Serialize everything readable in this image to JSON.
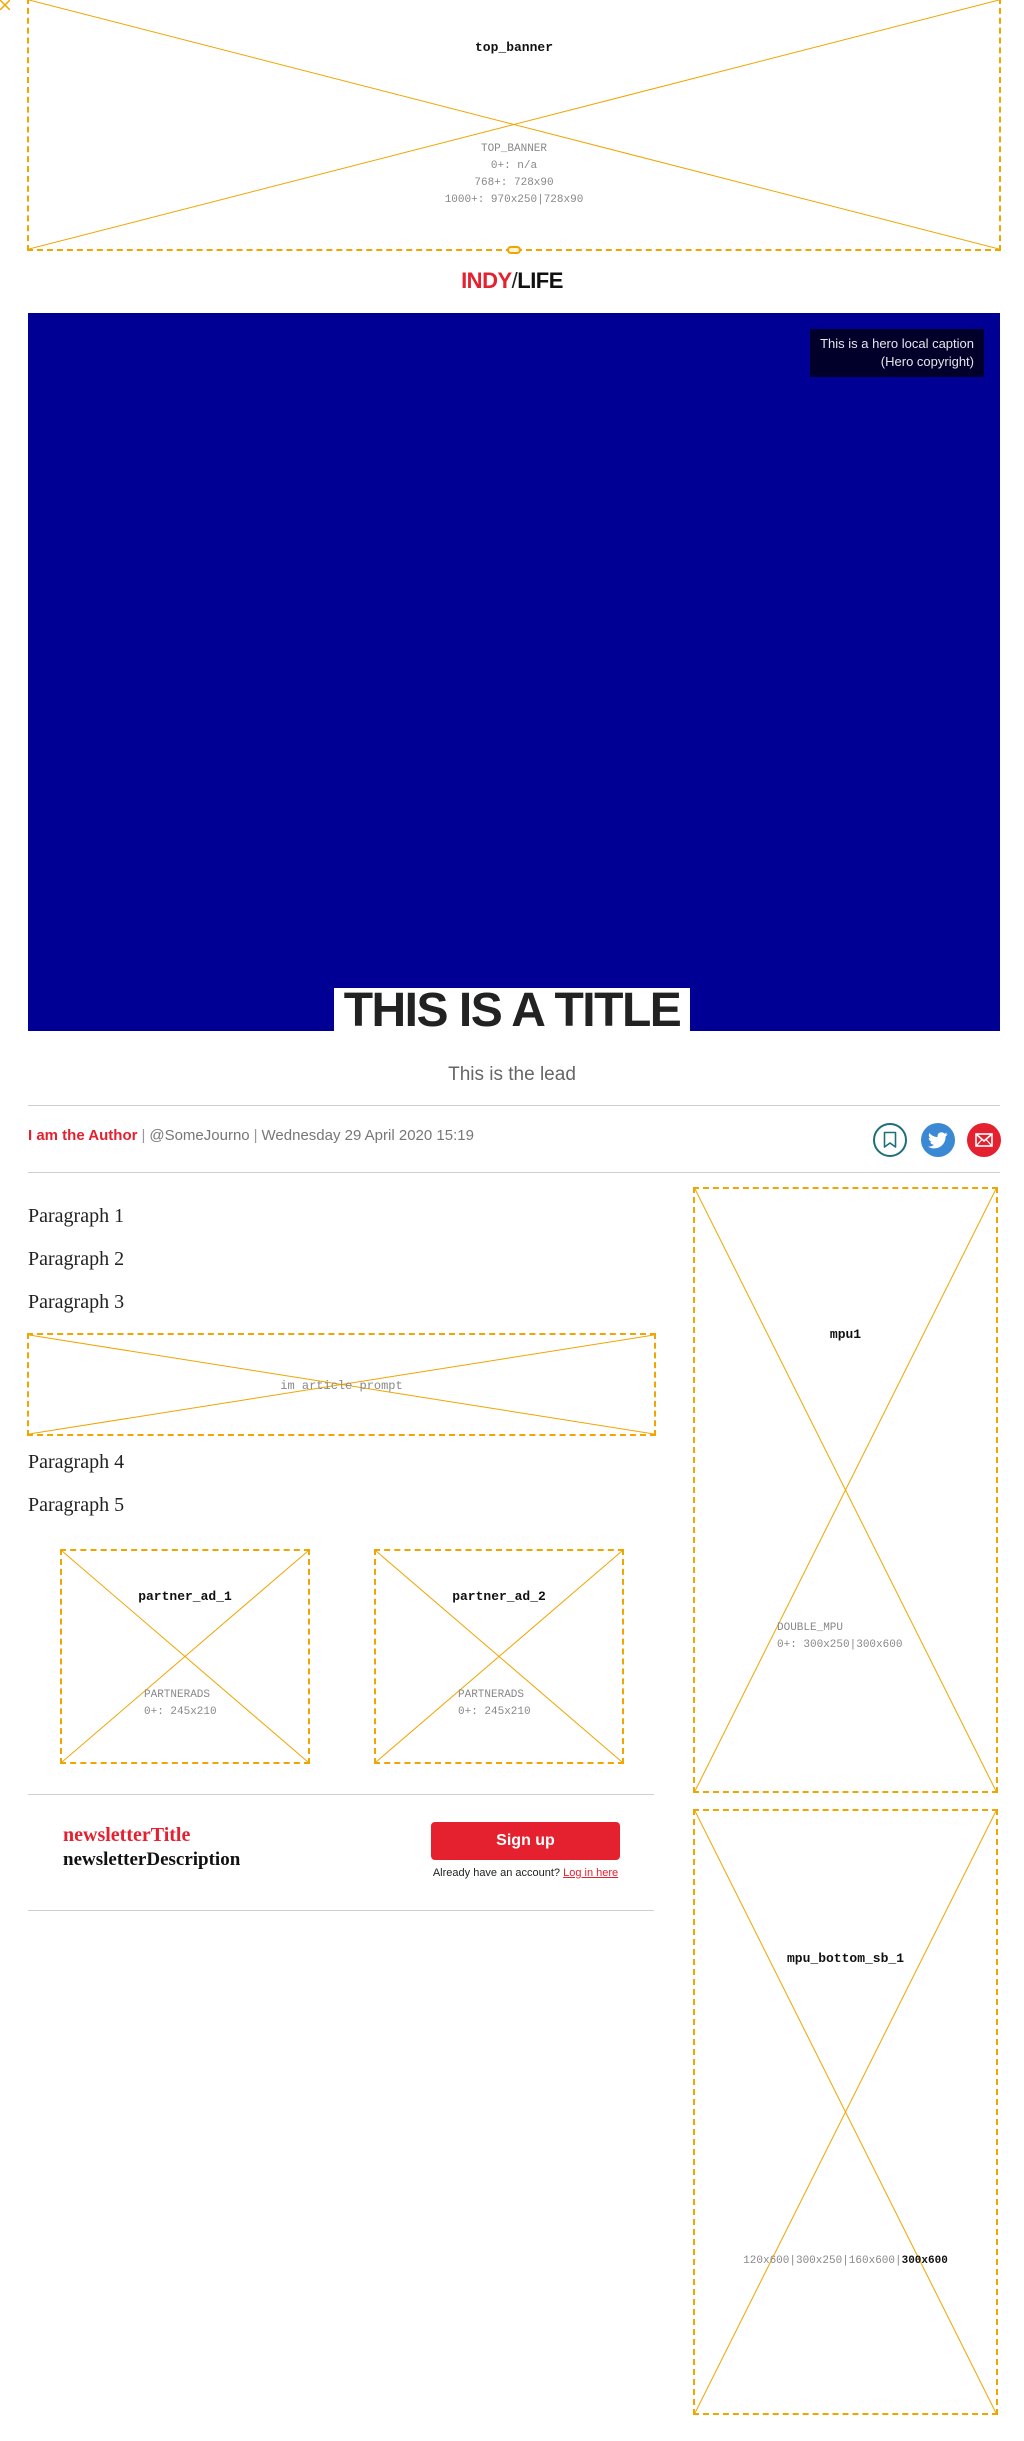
{
  "ads": {
    "top_banner": {
      "name": "top_banner",
      "info": [
        "TOP_BANNER",
        "0+: n/a",
        "768+: 728x90",
        "1000+: 970x250|728x90"
      ]
    },
    "in_article_prompt": {
      "name": "im article prompt"
    },
    "partner_ad_1": {
      "name": "partner_ad_1",
      "info": [
        "PARTNERADS",
        "0+: 245x210"
      ]
    },
    "partner_ad_2": {
      "name": "partner_ad_2",
      "info": [
        "PARTNERADS",
        "0+: 245x210"
      ]
    },
    "mpu1": {
      "name": "mpu1",
      "info": [
        "DOUBLE_MPU",
        "0+: 300x250|300x600"
      ]
    },
    "mpu_bottom_sb_1": {
      "name": "mpu_bottom_sb_1",
      "sizes": "120x600|300x250|160x600|",
      "selected_size": "300x600"
    }
  },
  "logo": {
    "left": "INDY",
    "slash": "/",
    "right": "LIFE"
  },
  "colors": {
    "brand_red": "#e5202f",
    "hero_blue": "#000094",
    "ad_outline": "#f0a500",
    "twitter_blue": "#3b88d4",
    "bookmark_teal": "#1f6f7a"
  },
  "hero": {
    "caption_line1": "This is a hero local caption",
    "caption_line2": "(Hero copyright)"
  },
  "article": {
    "title": "THIS IS A TITLE",
    "lead": "This is the lead",
    "byline": {
      "author": "I am the Author",
      "handle": "@SomeJourno",
      "date": "Wednesday 29 April 2020 15:19"
    },
    "share_icons": [
      "bookmark-icon",
      "twitter-icon",
      "email-icon"
    ],
    "paragraphs": [
      "Paragraph 1",
      "Paragraph 2",
      "Paragraph 3",
      "Paragraph 4",
      "Paragraph 5"
    ]
  },
  "newsletter": {
    "title": "newsletterTitle",
    "description": "newsletterDescription",
    "signup_label": "Sign up",
    "login_prompt": "Already have an account?",
    "login_link": "Log in here"
  }
}
